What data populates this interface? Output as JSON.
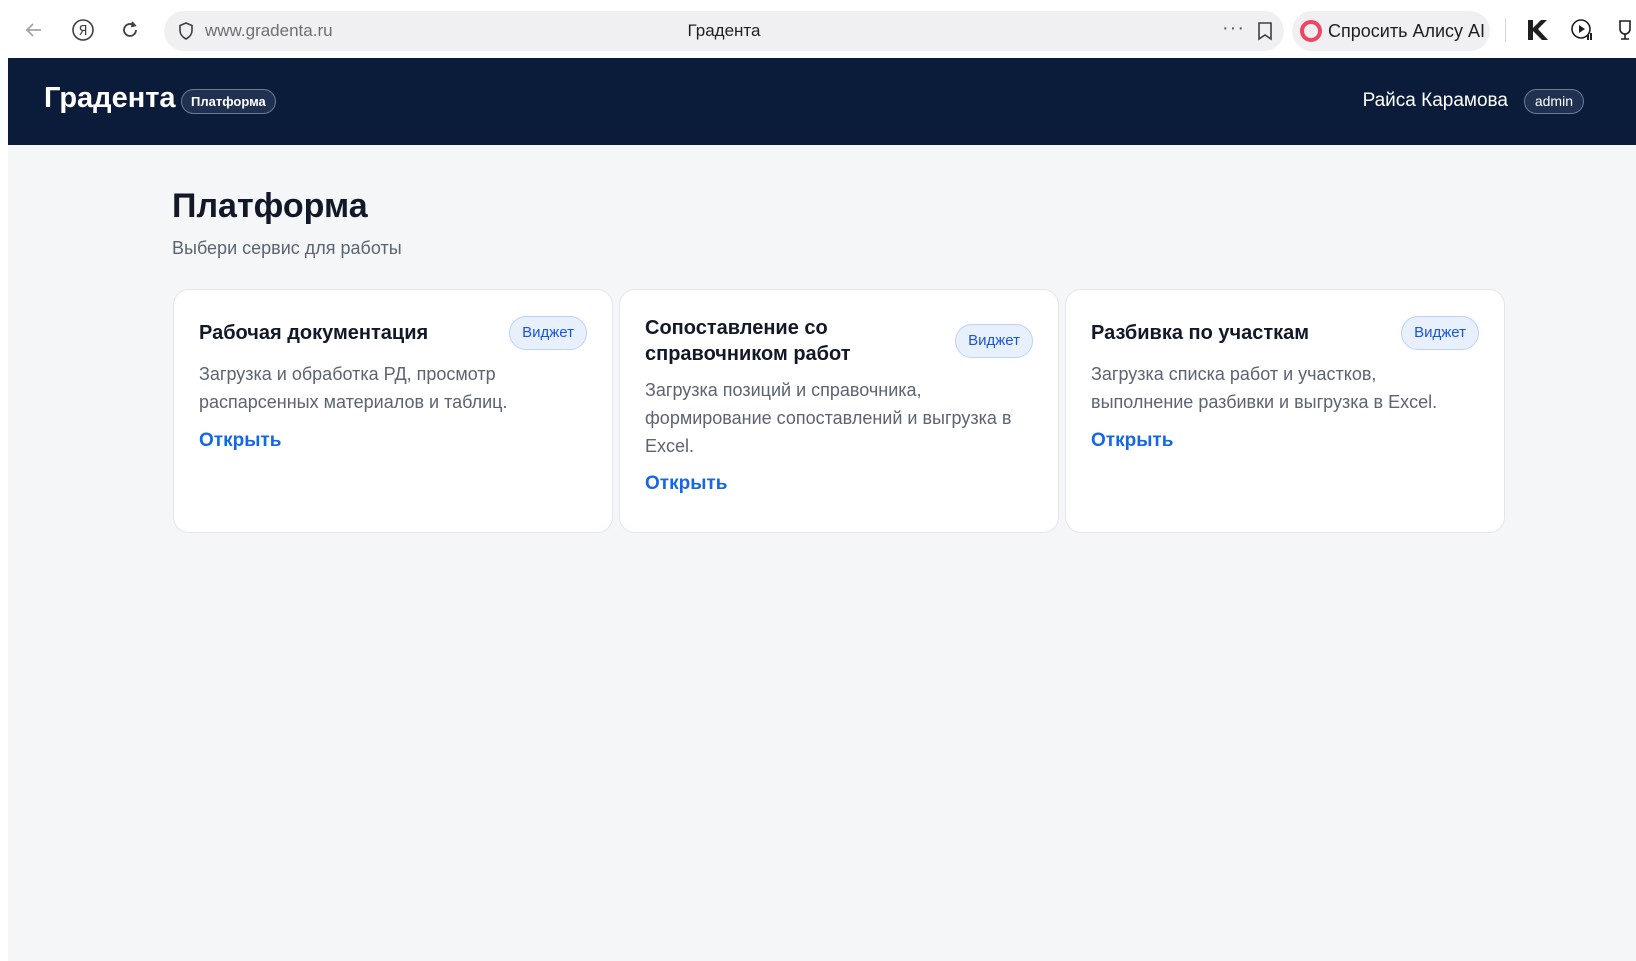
{
  "browser": {
    "url": "www.gradenta.ru",
    "tab_title": "Градента",
    "alice_label": "Спросить Алису AI",
    "menu_dots": "···"
  },
  "header": {
    "brand": "Градента",
    "brand_badge": "Платформа",
    "user_name": "Райса Карамова",
    "role": "admin"
  },
  "main": {
    "title": "Платформа",
    "subtitle": "Выбери сервис для работы",
    "cards": [
      {
        "title": "Рабочая документация",
        "badge": "Виджет",
        "description": "Загрузка и обработка РД, просмотр распарсенных материалов и таблиц.",
        "link": "Открыть"
      },
      {
        "title": "Сопоставление со справочником работ",
        "badge": "Виджет",
        "description": "Загрузка позиций и справочника, формирование сопоставлений и выгрузка в Excel.",
        "link": "Открыть"
      },
      {
        "title": "Разбивка по участкам",
        "badge": "Виджет",
        "description": "Загрузка списка работ и участков, выполнение разбивки и выгрузка в Excel.",
        "link": "Открыть"
      }
    ]
  },
  "colors": {
    "header_bg": "#0b1c3a",
    "page_bg": "#f5f6f8",
    "link": "#1467e6",
    "badge_bg": "#e8f0fe"
  }
}
